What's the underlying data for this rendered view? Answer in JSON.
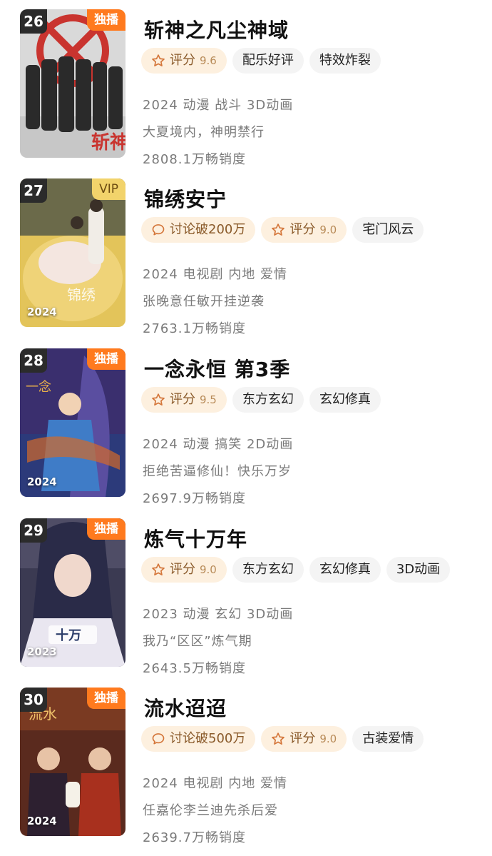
{
  "items": [
    {
      "rank": "26",
      "badge": "独播",
      "badge_type": "exclusive",
      "year_overlay": "",
      "title": "斩神之凡尘神域",
      "rating_label": "评分",
      "rating_value": "9.6",
      "tags": [
        "配乐好评",
        "特效炸裂"
      ],
      "meta": "2024 动漫 战斗 3D动画",
      "tagline": "大夏境内，神明禁行",
      "sales": "2808.1万畅销度"
    },
    {
      "rank": "27",
      "badge": "VIP",
      "badge_type": "vip",
      "year_overlay": "2024",
      "title": "锦绣安宁",
      "discuss_label": "讨论破200万",
      "rating_label": "评分",
      "rating_value": "9.0",
      "tags": [
        "宅门风云"
      ],
      "meta": "2024 电视剧 内地 爱情",
      "tagline": "张晚意任敏开挂逆袭",
      "sales": "2763.1万畅销度"
    },
    {
      "rank": "28",
      "badge": "独播",
      "badge_type": "exclusive",
      "year_overlay": "2024",
      "title": "一念永恒 第3季",
      "rating_label": "评分",
      "rating_value": "9.5",
      "tags": [
        "东方玄幻",
        "玄幻修真"
      ],
      "meta": "2024 动漫 搞笑 2D动画",
      "tagline": "拒绝苦逼修仙！快乐万岁",
      "sales": "2697.9万畅销度"
    },
    {
      "rank": "29",
      "badge": "独播",
      "badge_type": "exclusive",
      "year_overlay": "2023",
      "title": "炼气十万年",
      "rating_label": "评分",
      "rating_value": "9.0",
      "tags": [
        "东方玄幻",
        "玄幻修真",
        "3D动画"
      ],
      "meta": "2023 动漫 玄幻 3D动画",
      "tagline": "我乃“区区”炼气期",
      "sales": "2643.5万畅销度"
    },
    {
      "rank": "30",
      "badge": "独播",
      "badge_type": "exclusive",
      "year_overlay": "2024",
      "title": "流水迢迢",
      "discuss_label": "讨论破500万",
      "rating_label": "评分",
      "rating_value": "9.0",
      "tags": [
        "古装爱情"
      ],
      "meta": "2024 电视剧 内地 爱情",
      "tagline": "任嘉伦李兰迪先杀后爱",
      "sales": "2639.7万畅销度"
    }
  ],
  "colors": {
    "exclusive_badge": "#ff7a1e",
    "vip_badge": "#f2d36b",
    "rank_bg": "#2b2b2b",
    "rating_tag_bg": "#fdf0df",
    "tag_bg": "#f4f4f4"
  },
  "icons": {
    "rating": "star-icon",
    "discuss": "chat-bubble-icon"
  }
}
